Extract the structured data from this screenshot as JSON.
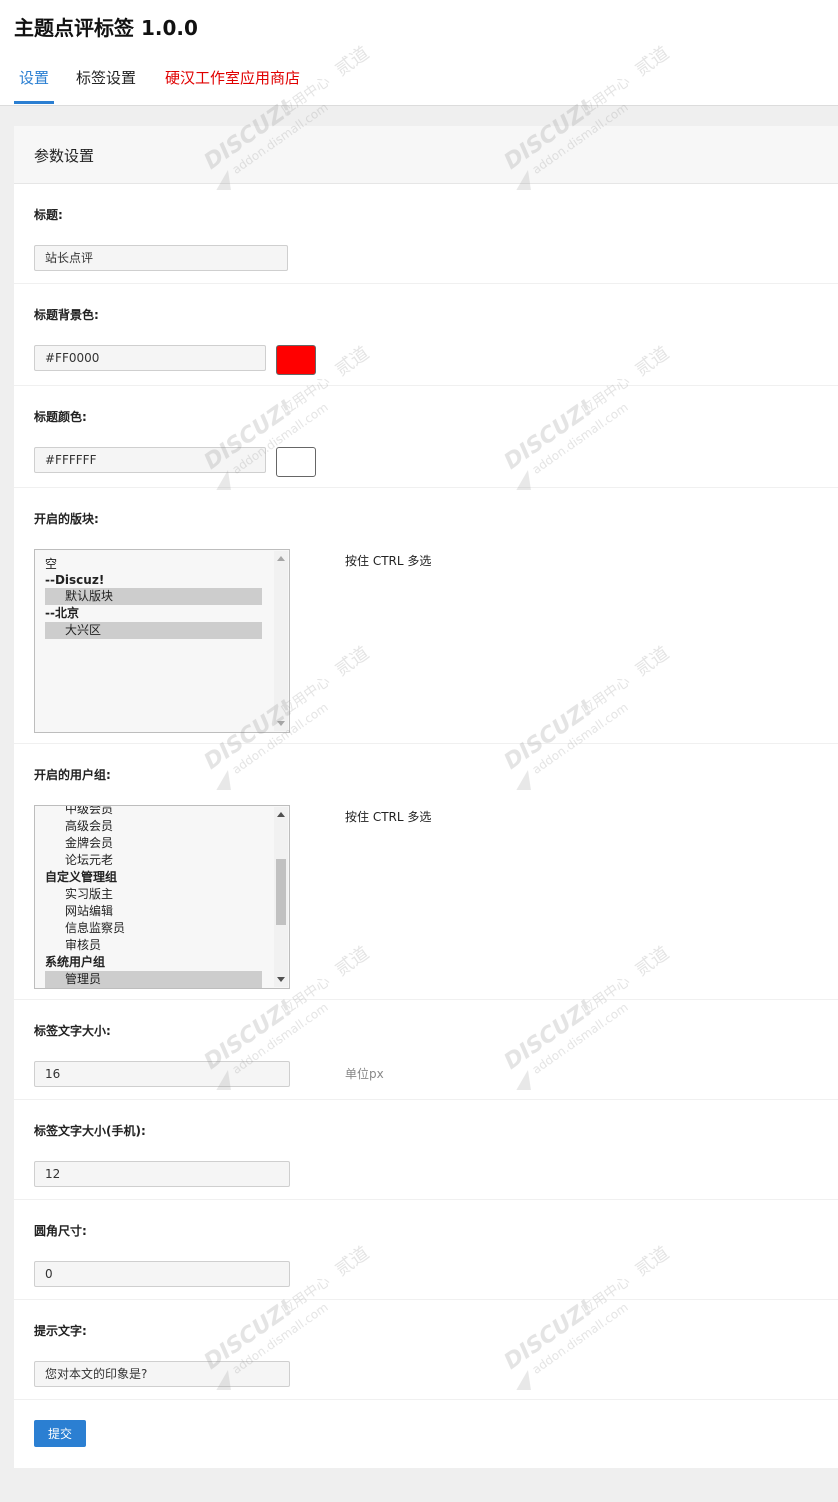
{
  "app": {
    "title": "主题点评标签 1.0.0"
  },
  "tabs": [
    {
      "label": "设置",
      "active": true
    },
    {
      "label": "标签设置",
      "active": false
    },
    {
      "label": "硬汉工作室应用商店",
      "active": false
    }
  ],
  "panel": {
    "title": "参数设置"
  },
  "fields": {
    "title": {
      "label": "标题:",
      "value": "站长点评"
    },
    "title_bg": {
      "label": "标题背景色:",
      "value": "#FF0000",
      "color": "#FF0000"
    },
    "title_color": {
      "label": "标题颜色:",
      "value": "#FFFFFF",
      "color": "#FFFFFF"
    },
    "forums": {
      "label": "开启的版块:",
      "hint": "按住 CTRL 多选",
      "options": [
        {
          "text": "空",
          "kind": "item",
          "selected": false
        },
        {
          "text": "--Discuz!",
          "kind": "group",
          "selected": false
        },
        {
          "text": "默认版块",
          "kind": "child",
          "selected": true
        },
        {
          "text": "--北京",
          "kind": "group",
          "selected": false
        },
        {
          "text": "大兴区",
          "kind": "child",
          "selected": true
        }
      ]
    },
    "groups": {
      "label": "开启的用户组:",
      "hint": "按住 CTRL 多选",
      "options": [
        {
          "text": "中级会员",
          "kind": "child",
          "selected": false
        },
        {
          "text": "高级会员",
          "kind": "child",
          "selected": false
        },
        {
          "text": "金牌会员",
          "kind": "child",
          "selected": false
        },
        {
          "text": "论坛元老",
          "kind": "child",
          "selected": false
        },
        {
          "text": "自定义管理组",
          "kind": "group",
          "selected": false
        },
        {
          "text": "实习版主",
          "kind": "child",
          "selected": false
        },
        {
          "text": "网站编辑",
          "kind": "child",
          "selected": false
        },
        {
          "text": "信息监察员",
          "kind": "child",
          "selected": false
        },
        {
          "text": "审核员",
          "kind": "child",
          "selected": false
        },
        {
          "text": "系统用户组",
          "kind": "group",
          "selected": false
        },
        {
          "text": "管理员",
          "kind": "child",
          "selected": true
        }
      ]
    },
    "font_size": {
      "label": "标签文字大小:",
      "value": "16",
      "hint": "单位px"
    },
    "font_size_mobile": {
      "label": "标签文字大小(手机):",
      "value": "12"
    },
    "radius": {
      "label": "圆角尺寸:",
      "value": "0"
    },
    "prompt": {
      "label": "提示文字:",
      "value": "您对本文的印象是?"
    }
  },
  "submit": {
    "label": "提交"
  },
  "watermark": {
    "brand": "DISCUZ!",
    "center": "应用中心",
    "site": "addon.dismall.com",
    "mark": "贰道"
  },
  "colors": {
    "accent": "#2b7fd2",
    "store_link": "#e00000",
    "button": "#2b7fd2"
  }
}
